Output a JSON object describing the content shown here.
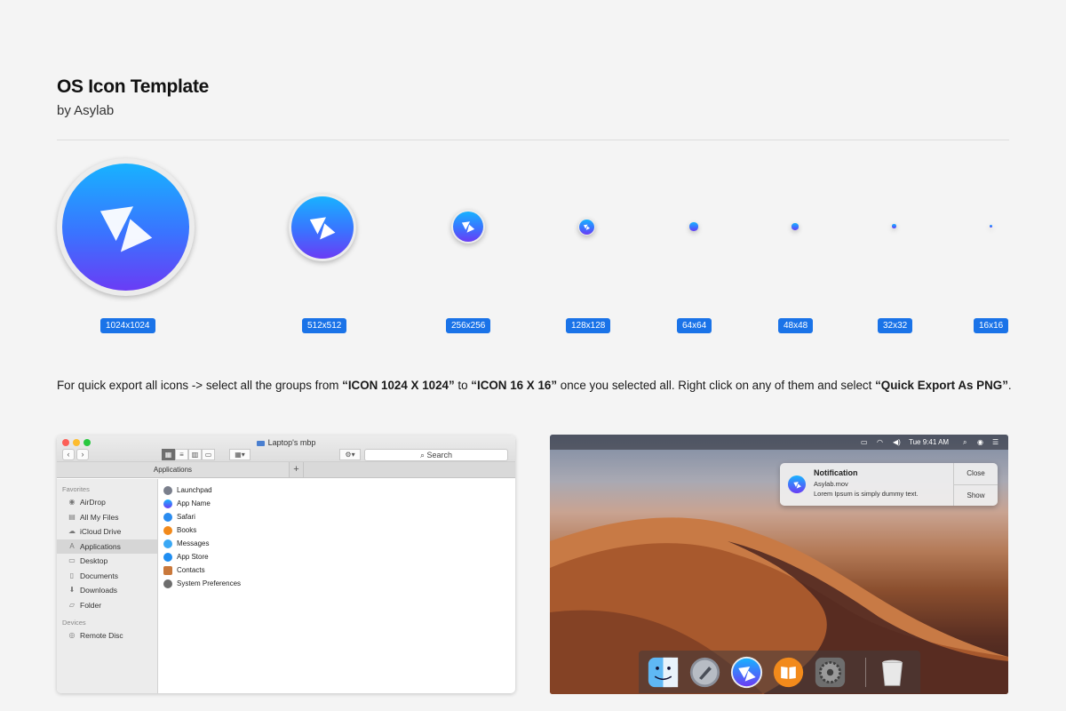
{
  "header": {
    "title": "OS Icon Template",
    "subtitle": "by Asylab"
  },
  "icon_sizes": [
    "1024x1024",
    "512x512",
    "256x256",
    "128x128",
    "64x64",
    "48x48",
    "32x32",
    "16x16"
  ],
  "instructions": {
    "part1": "For quick export all icons -> select all the groups from ",
    "bold1": "“ICON 1024 X 1024”",
    "part2": " to ",
    "bold2": "“ICON 16 X 16”",
    "part3": " once you selected all. Right click on any of them and select ",
    "bold3": "“Quick Export As PNG”",
    "part4": "."
  },
  "finder": {
    "window_title": "Laptop's mbp",
    "search_label": "Search",
    "tab_label": "Applications",
    "tab_add": "+",
    "sidebar": {
      "favorites_header": "Favorites",
      "favorites": [
        "AirDrop",
        "All My Files",
        "iCloud Drive",
        "Applications",
        "Desktop",
        "Documents",
        "Downloads",
        "Folder"
      ],
      "devices_header": "Devices",
      "devices": [
        "Remote Disc"
      ]
    },
    "files": [
      "Launchpad",
      "App Name",
      "Safari",
      "Books",
      "Messages",
      "App Store",
      "Contacts",
      "System Preferences"
    ]
  },
  "desktop": {
    "clock": "Tue 9:41 AM",
    "notification": {
      "title": "Notification",
      "filename": "Asylab.mov",
      "body": "Lorem Ipsum is simply dummy text.",
      "close_label": "Close",
      "show_label": "Show"
    },
    "dock_items": [
      "finder-icon",
      "launchpad-icon",
      "app-icon",
      "books-icon",
      "system-preferences-icon",
      "trash-icon"
    ]
  },
  "colors": {
    "accent": "#1a73e8",
    "icon_top": "#18b2ff",
    "icon_bottom": "#6a3cf5"
  }
}
